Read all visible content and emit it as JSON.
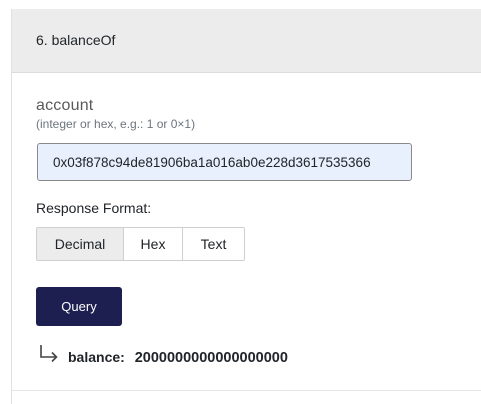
{
  "method": {
    "title": "6. balanceOf"
  },
  "input": {
    "label": "account",
    "hint": "(integer or hex, e.g.: 1 or 0×1)",
    "value": "0x03f878c94de81906ba1a016ab0e228d3617535366"
  },
  "response_format": {
    "label": "Response Format:",
    "options": [
      "Decimal",
      "Hex",
      "Text"
    ],
    "selected": "Decimal"
  },
  "query_button": {
    "label": "Query"
  },
  "result": {
    "key": "balance:",
    "value": "2000000000000000000",
    "icon": "return-arrow-icon"
  },
  "colors": {
    "header_bg": "#ececec",
    "input_bg": "#e8f0fe",
    "button_bg": "#1c1f4f",
    "selected_option_bg": "#ececec"
  }
}
